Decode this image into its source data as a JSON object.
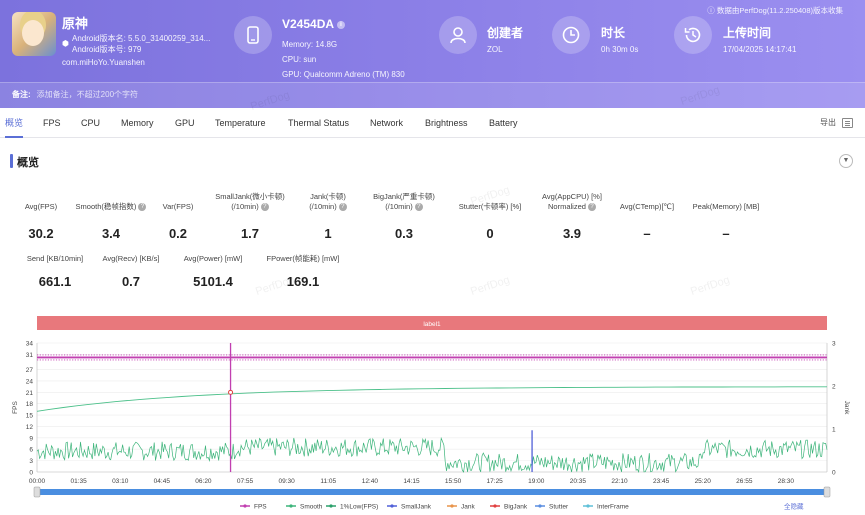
{
  "app": {
    "name": "原神",
    "version_line": "Android版本名: 5.5.0_31400259_314...",
    "build_line": "Android版本号: 979",
    "package": "com.miHoYo.Yuanshen"
  },
  "device": {
    "model": "V2454DA",
    "memory": "Memory: 14.8G",
    "cpu": "CPU: sun",
    "gpu": "GPU: Qualcomm Adreno (TM) 830"
  },
  "creator": {
    "title": "创建者",
    "value": "ZOL"
  },
  "duration": {
    "title": "时长",
    "value": "0h 30m 0s"
  },
  "upload": {
    "title": "上传时间",
    "value": "17/04/2025 14:17:41"
  },
  "source_note": "数据由PerfDog(11.2.250408)版本收集",
  "note": {
    "label": "备注:",
    "placeholder": "添加备注，不超过200个字符"
  },
  "tabs": [
    "概览",
    "FPS",
    "CPU",
    "Memory",
    "GPU",
    "Temperature",
    "Thermal Status",
    "Network",
    "Brightness",
    "Battery"
  ],
  "export_label": "导出",
  "section_title": "概览",
  "metrics_row1": [
    {
      "label": "Avg(FPS)",
      "value": "30.2"
    },
    {
      "label": "Smooth(稳帧指数)",
      "value": "3.4"
    },
    {
      "label": "Var(FPS)",
      "value": "0.2"
    },
    {
      "label": "SmallJank(微小卡顿)",
      "label2": "(/10min)",
      "value": "1.7"
    },
    {
      "label": "Jank(卡顿)",
      "label2": "(/10min)",
      "value": "1"
    },
    {
      "label": "BigJank(严重卡顿)",
      "label2": "(/10min)",
      "value": "0.3"
    },
    {
      "label": "Stutter(卡顿率) [%]",
      "value": "0"
    },
    {
      "label": "Avg(AppCPU) [%]",
      "label2": "Normalized",
      "value": "3.9"
    },
    {
      "label": "Avg(CTemp)[℃]",
      "value": "–"
    },
    {
      "label": "Peak(Memory) [MB]",
      "value": "–"
    }
  ],
  "metrics_row2": [
    {
      "label": "Send [KB/10min]",
      "value": "661.1"
    },
    {
      "label": "Avg(Recv) [KB/s]",
      "value": "0.7"
    },
    {
      "label": "Avg(Power) [mW]",
      "value": "5101.4"
    },
    {
      "label": "FPower(帧能耗) [mW]",
      "value": "169.1"
    }
  ],
  "watermark": "PerfDog",
  "chart_data": {
    "type": "line",
    "label_band": "label1",
    "ylabel_left": "FPS",
    "ylabel_right": "Jank",
    "yticks_left": [
      0,
      3,
      6,
      9,
      12,
      15,
      18,
      21,
      24,
      27,
      31,
      34
    ],
    "yticks_right": [
      0,
      1,
      2,
      3
    ],
    "xticks": [
      "00:00",
      "01:35",
      "03:10",
      "04:45",
      "06:20",
      "07:55",
      "09:30",
      "11:05",
      "12:40",
      "14:15",
      "15:50",
      "17:25",
      "19:00",
      "20:35",
      "22:10",
      "23:45",
      "25:20",
      "26:55",
      "28:30"
    ],
    "legend": [
      "FPS",
      "Smooth",
      "1%Low(FPS)",
      "SmallJank",
      "Jank",
      "BigJank",
      "Stutter",
      "InterFrame"
    ],
    "legend_colors": [
      "#c13fb0",
      "#3cb47a",
      "#2aa06a",
      "#5060d8",
      "#e8944a",
      "#e04040",
      "#5a8ee0",
      "#5fc0d8"
    ],
    "fps_level": 30.2,
    "smooth_start": 16,
    "smooth_end": 22.5,
    "interframe_mean_segments": [
      {
        "from_min": 0,
        "to_min": 7.5,
        "mean": 5.5
      },
      {
        "from_min": 7.5,
        "to_min": 15.5,
        "mean": 6.5
      },
      {
        "from_min": 15.5,
        "to_min": 25.2,
        "mean": 2.5
      },
      {
        "from_min": 25.2,
        "to_min": 30,
        "mean": 6.0
      }
    ],
    "spikes": [
      {
        "min": 7.35,
        "value": 34,
        "color": "#c13fb0"
      },
      {
        "min": 18.8,
        "value": 11,
        "color": "#5060d8"
      }
    ],
    "xmax_min": 30,
    "ylim": [
      0,
      34
    ],
    "full_hide_label": "全隐藏"
  }
}
